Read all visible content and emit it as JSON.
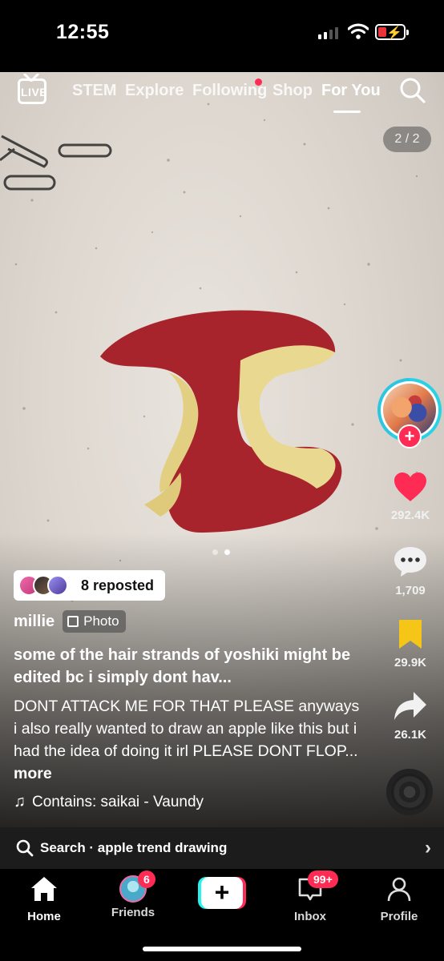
{
  "status_bar": {
    "time": "12:55"
  },
  "top_nav": {
    "live_label": "LIVE",
    "tabs": [
      {
        "label": "STEM",
        "active": false
      },
      {
        "label": "Explore",
        "active": false
      },
      {
        "label": "Following",
        "active": false,
        "has_notification_dot": true
      },
      {
        "label": "Shop",
        "active": false
      },
      {
        "label": "For You",
        "active": true
      }
    ]
  },
  "post": {
    "photo_counter": "2 / 2",
    "reposted_label": "8 reposted",
    "username": "millie",
    "post_type_label": "Photo",
    "caption_title": "some of the hair strands of yoshiki might be edited bc i simply dont hav...",
    "caption_body": "DONT ATTACK ME FOR THAT PLEASE anyways i also really wanted to draw an apple like this but i had the idea of doing it irl PLEASE DONT FLOP...",
    "caption_more": "more",
    "sound": "Contains: saikai - Vaundy"
  },
  "actions": {
    "likes": "292.4K",
    "comments": "1,709",
    "saves": "29.9K",
    "shares": "26.1K"
  },
  "search_suggestion": "Search · apple trend drawing",
  "bottom_tabs": {
    "home": "Home",
    "friends": "Friends",
    "friends_badge": "6",
    "inbox": "Inbox",
    "inbox_badge": "99+",
    "profile": "Profile"
  },
  "colors": {
    "accent_red": "#fe2c55",
    "accent_cyan": "#25f4ee",
    "save_yellow": "#f5c518",
    "like_red": "#fe2c55"
  }
}
